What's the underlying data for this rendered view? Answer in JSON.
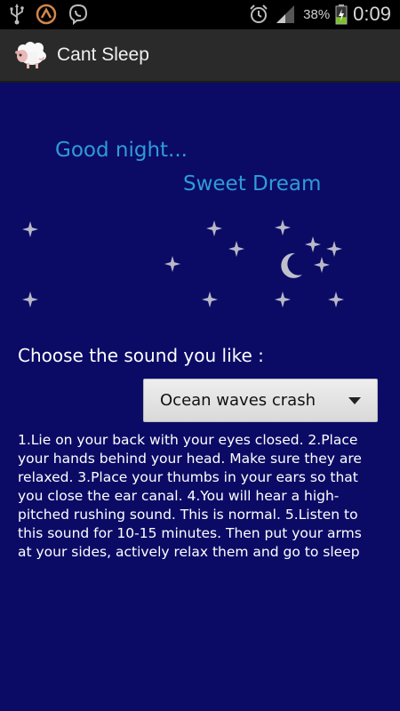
{
  "status_bar": {
    "left_icons": [
      "usb-icon",
      "avast-icon",
      "viber-icon"
    ],
    "right_icons": [
      "alarm-icon",
      "signal-icon"
    ],
    "battery_percent": "38%",
    "battery_level": 0.38,
    "time": "0:09"
  },
  "action_bar": {
    "app_icon": "sheep-icon",
    "title": "Cant Sleep"
  },
  "main": {
    "greeting_line1": "Good night...",
    "greeting_line2": "Sweet Dream",
    "decor": [
      "star-icon",
      "moon-icon"
    ],
    "choose_label": "Choose the sound you like :",
    "sound_select": {
      "selected": "Ocean waves crash"
    },
    "instructions": "1.Lie on your back with your eyes closed. 2.Place your hands behind your head. Make sure they are relaxed. 3.Place your thumbs in your ears so that you close the ear canal. 4.You will hear a high-pitched rushing sound. This is normal. 5.Listen to this sound for 10-15 minutes. Then put your arms at your sides, actively relax them and go to sleep"
  },
  "colors": {
    "background": "#0b0b66",
    "greeting": "#2f9bd6",
    "action_bar": "#2a2a2a",
    "battery_green": "#7ec02a"
  }
}
